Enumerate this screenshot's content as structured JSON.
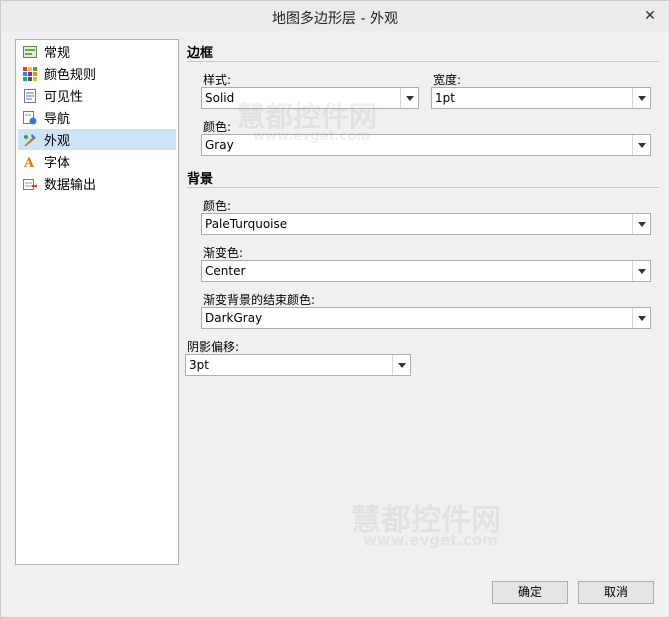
{
  "window": {
    "title": "地图多边形层 - 外观",
    "close_symbol": "✕"
  },
  "nav": {
    "items": [
      {
        "label": "常规",
        "icon": "general-icon"
      },
      {
        "label": "颜色规则",
        "icon": "color-rules-icon"
      },
      {
        "label": "可见性",
        "icon": "visibility-icon"
      },
      {
        "label": "导航",
        "icon": "navigation-icon"
      },
      {
        "label": "外观",
        "icon": "appearance-icon",
        "selected": true
      },
      {
        "label": "字体",
        "icon": "font-icon"
      },
      {
        "label": "数据输出",
        "icon": "data-output-icon"
      }
    ]
  },
  "border": {
    "title": "边框",
    "style_label": "样式:",
    "style_value": "Solid",
    "width_label": "宽度:",
    "width_value": "1pt",
    "color_label": "颜色:",
    "color_value": "Gray"
  },
  "background": {
    "title": "背景",
    "color_label": "颜色:",
    "color_value": "PaleTurquoise",
    "gradient_label": "渐变色:",
    "gradient_value": "Center",
    "gradient_end_label": "渐变背景的结束颜色:",
    "gradient_end_value": "DarkGray"
  },
  "shadow": {
    "label": "阴影偏移:",
    "value": "3pt"
  },
  "buttons": {
    "ok": "确定",
    "cancel": "取消"
  },
  "watermark": {
    "line1": "慧都控件网",
    "line2": "www.evget.com"
  },
  "colors": {
    "selection": "#cfe3f7",
    "nav_border": "#b0b0b0"
  }
}
